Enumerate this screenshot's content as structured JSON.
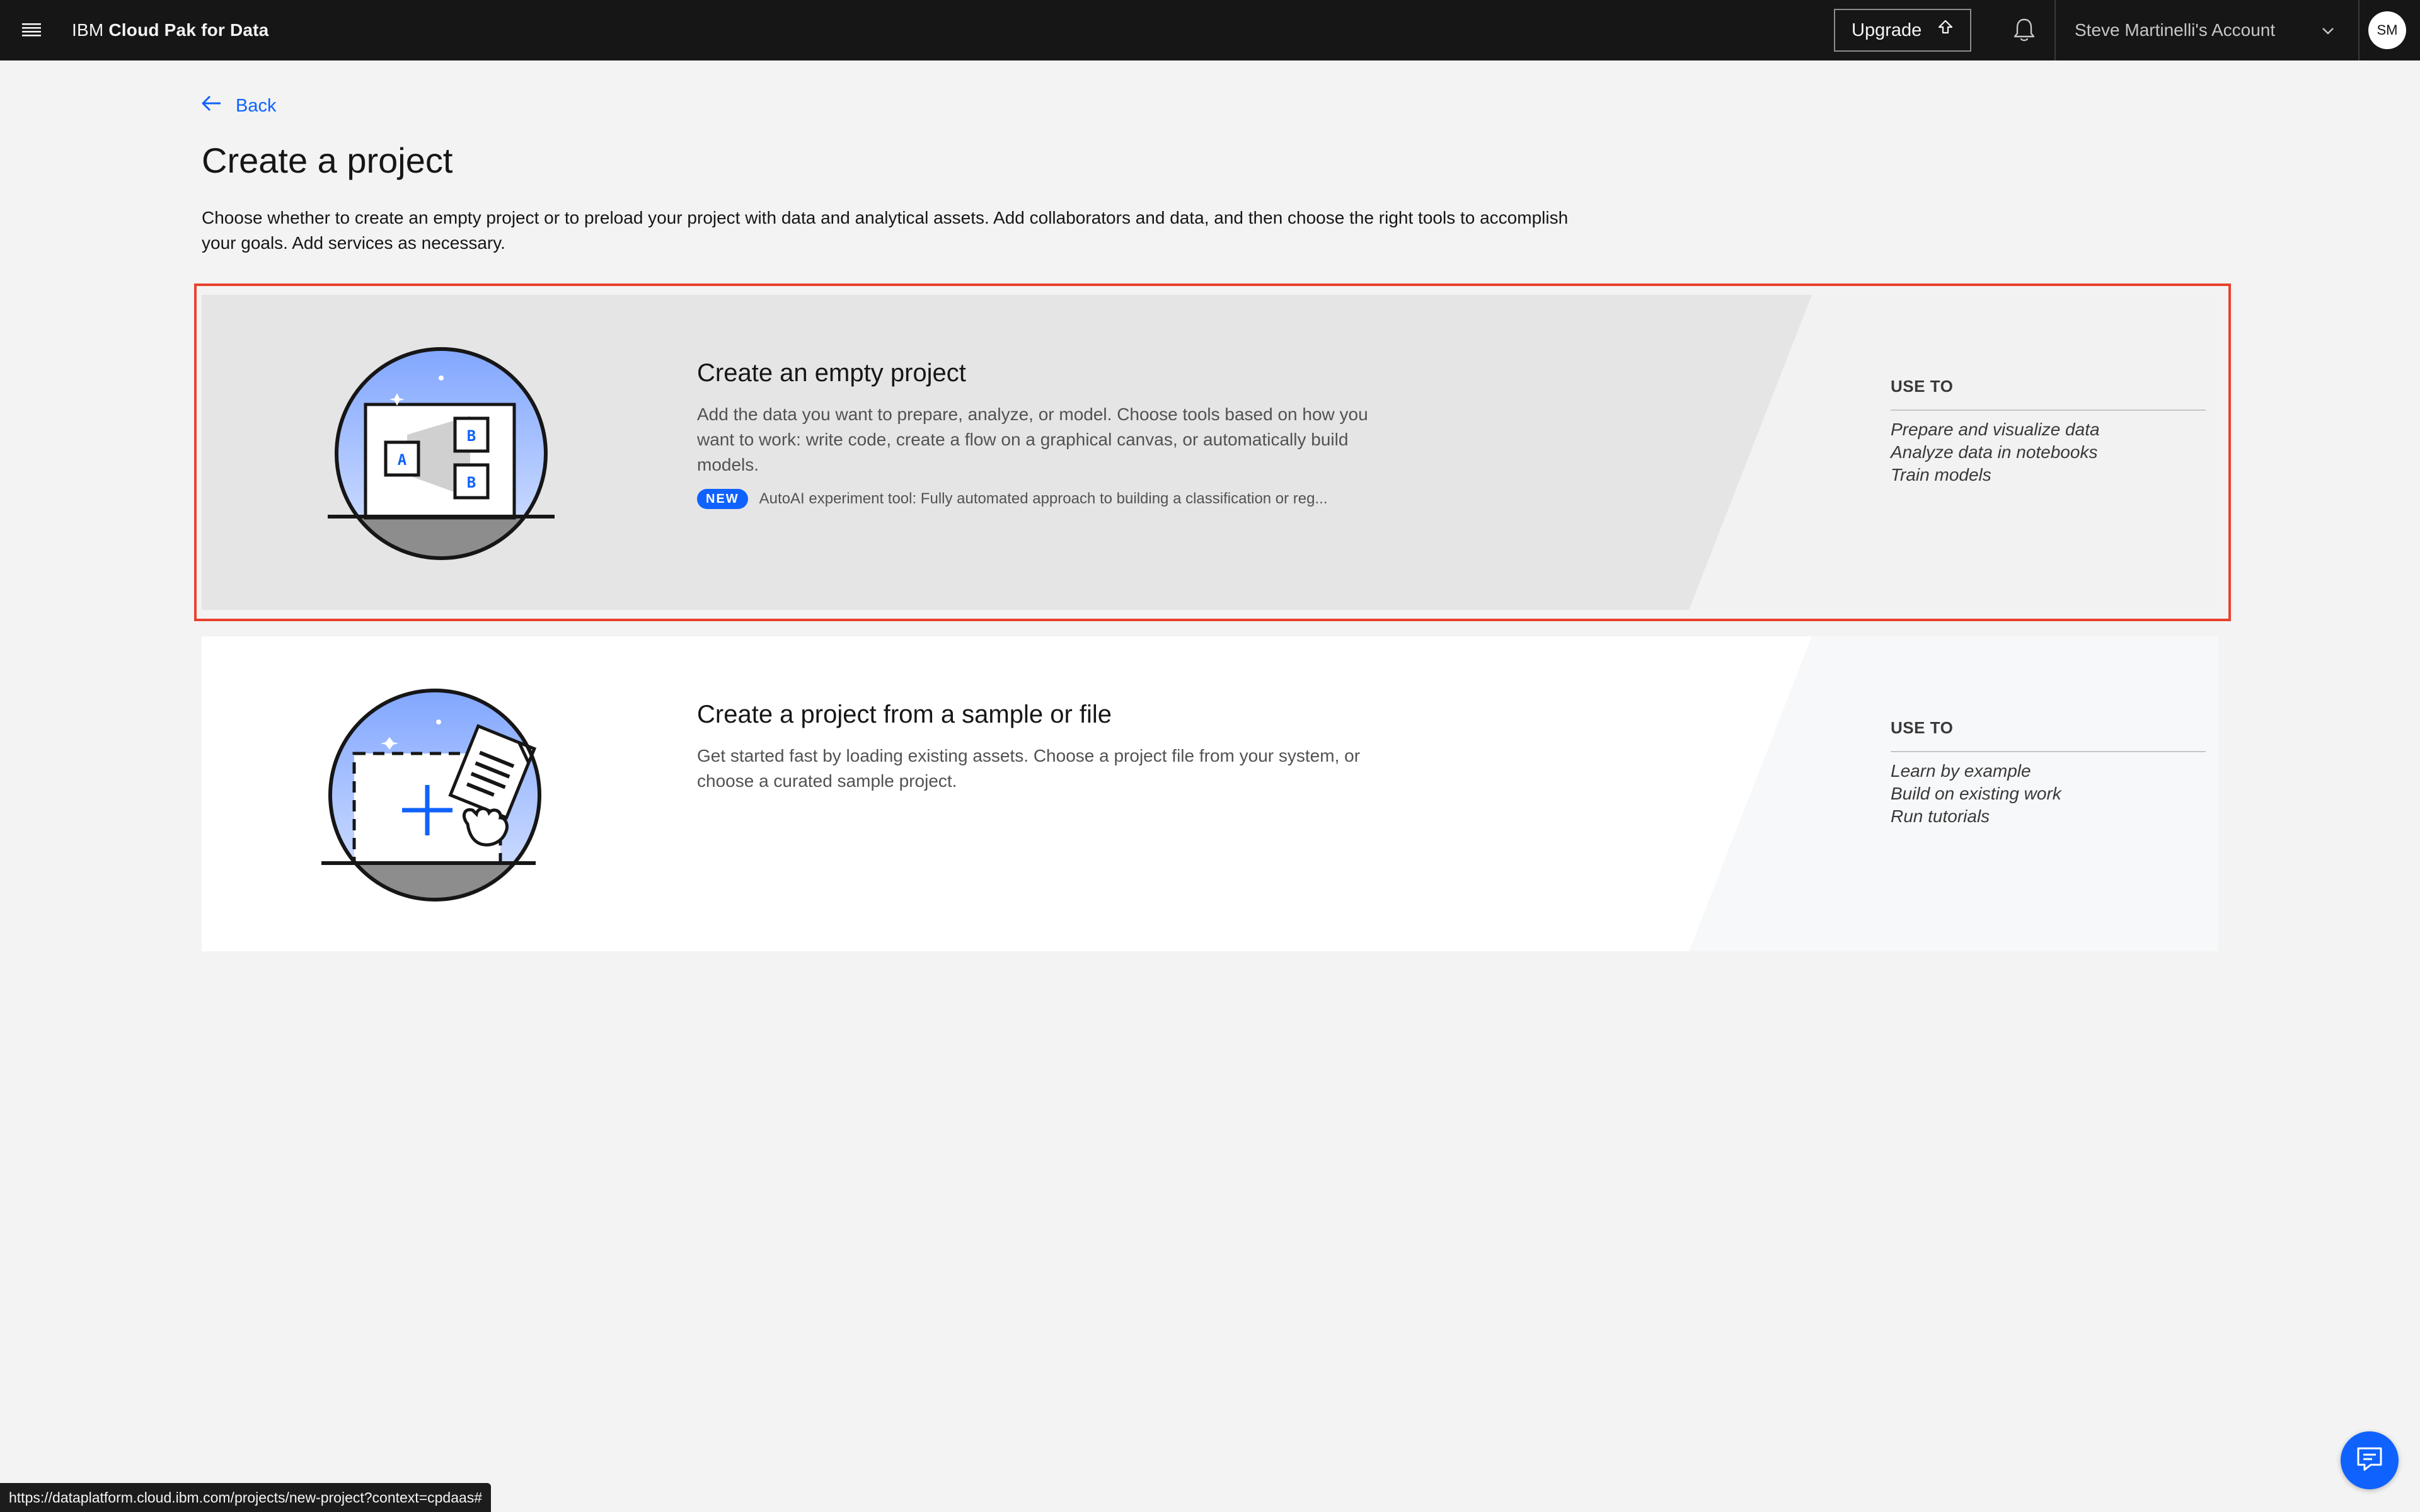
{
  "header": {
    "brand_prefix": "IBM",
    "brand_name": "Cloud Pak for Data",
    "upgrade_label": "Upgrade",
    "account_name": "Steve Martinelli's Account",
    "avatar_initials": "SM",
    "icons": [
      "menu-icon",
      "upload-icon",
      "notification-icon",
      "chevron-down-icon"
    ]
  },
  "nav": {
    "back_label": "Back"
  },
  "page": {
    "title": "Create a project",
    "description": "Choose whether to create an empty project or to preload your project with data and analytical assets. Add collaborators and data, and then choose the right tools to accomplish your goals. Add services as necessary."
  },
  "options": [
    {
      "title": "Create an empty project",
      "description": "Add the data you want to prepare, analyze, or model. Choose tools based on how you want to work: write code, create a flow on a graphical canvas, or automatically build models.",
      "badge": "NEW",
      "badge_text": "AutoAI experiment tool: Fully automated approach to building a classification or reg...",
      "use_to_label": "USE TO",
      "use_to": [
        "Prepare and visualize data",
        "Analyze data in notebooks",
        "Train models"
      ],
      "selected": true
    },
    {
      "title": "Create a project from a sample or file",
      "description": "Get started fast by loading existing assets. Choose a project file from your system, or choose a curated sample project.",
      "use_to_label": "USE TO",
      "use_to": [
        "Learn by example",
        "Build on existing work",
        "Run tutorials"
      ],
      "selected": false
    }
  ],
  "status_bar": {
    "url": "https://dataplatform.cloud.ibm.com/projects/new-project?context=cpdaas#"
  },
  "colors": {
    "header_bg": "#161616",
    "accent": "#0f62fe",
    "selection_outline": "#e8412d",
    "tile_selected_bg": "#e5e5e5",
    "tile_bg": "#ffffff",
    "page_bg": "#f3f3f3"
  },
  "chat": {
    "icon": "chat-icon"
  }
}
